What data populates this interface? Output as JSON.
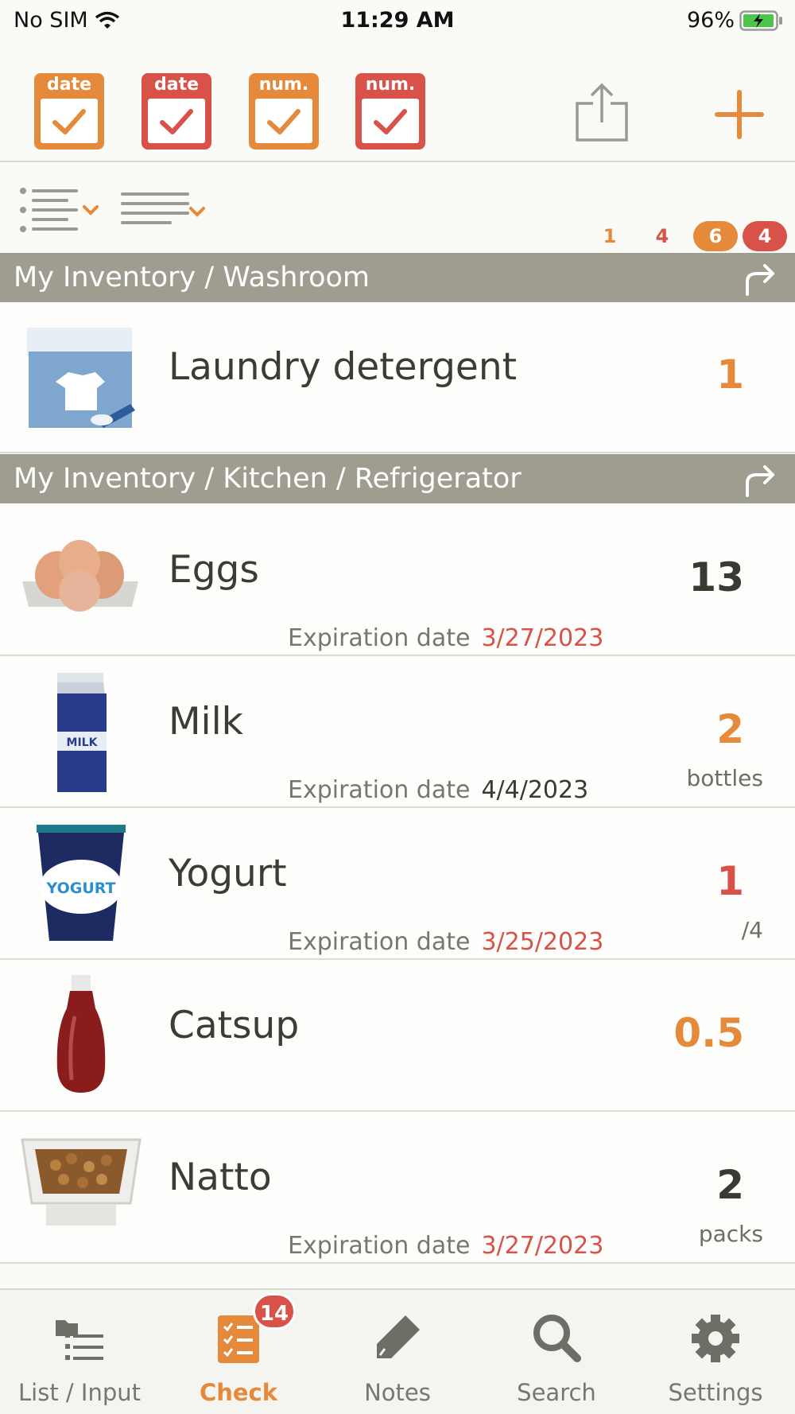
{
  "status_bar": {
    "carrier": "No SIM",
    "time": "11:29 AM",
    "battery": "96%"
  },
  "toolbar": {
    "filters": [
      {
        "label": "date",
        "color": "#e58a3a"
      },
      {
        "label": "date",
        "color": "#d9524a"
      },
      {
        "label": "num.",
        "color": "#e58a3a"
      },
      {
        "label": "num.",
        "color": "#d9524a"
      }
    ],
    "icons": {
      "share": "share-icon",
      "add": "plus-icon"
    }
  },
  "summary_counts": {
    "orange_date": "1",
    "red_date": "4",
    "orange_num": "6",
    "red_num": "4"
  },
  "sections": [
    {
      "path": "My Inventory / Washroom"
    },
    {
      "path": "My Inventory / Kitchen / Refrigerator"
    }
  ],
  "items": [
    {
      "name": "Laundry detergent",
      "qty": "1",
      "qty_color": "#e58a3a",
      "exp_label": "",
      "exp_date": "",
      "unit": ""
    },
    {
      "name": "Eggs",
      "qty": "13",
      "qty_color": "#3a3a33",
      "exp_label": "Expiration date",
      "exp_date": "3/27/2023",
      "exp_color": "#d9524a",
      "unit": ""
    },
    {
      "name": "Milk",
      "qty": "2",
      "qty_color": "#e58a3a",
      "exp_label": "Expiration date",
      "exp_date": "4/4/2023",
      "exp_color": "#3a3a33",
      "unit": "bottles"
    },
    {
      "name": "Yogurt",
      "qty": "1",
      "qty_color": "#d9524a",
      "exp_label": "Expiration date",
      "exp_date": "3/25/2023",
      "exp_color": "#d9524a",
      "unit": "/4"
    },
    {
      "name": "Catsup",
      "qty": "0.5",
      "qty_color": "#e58a3a",
      "exp_label": "",
      "exp_date": "",
      "unit": ""
    },
    {
      "name": "Natto",
      "qty": "2",
      "qty_color": "#3a3a33",
      "exp_label": "Expiration date",
      "exp_date": "3/27/2023",
      "exp_color": "#d9524a",
      "unit": "packs"
    }
  ],
  "thumb_text": {
    "milk": "MILK",
    "yogurt": "YOGURT"
  },
  "tabs": [
    {
      "label": "List / Input",
      "icon": "folder-list-icon"
    },
    {
      "label": "Check",
      "icon": "checklist-icon",
      "badge": "14"
    },
    {
      "label": "Notes",
      "icon": "pencil-icon"
    },
    {
      "label": "Search",
      "icon": "search-icon"
    },
    {
      "label": "Settings",
      "icon": "gear-icon"
    }
  ]
}
